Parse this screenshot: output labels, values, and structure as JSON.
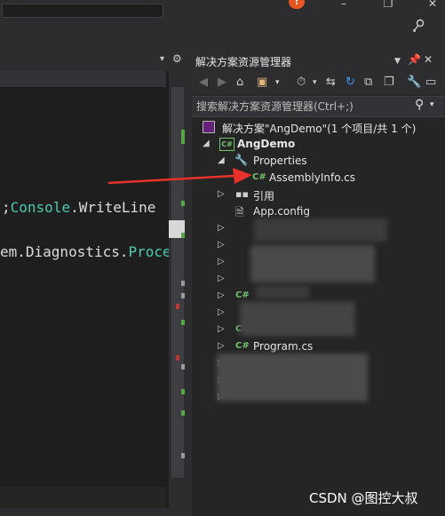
{
  "window": {
    "notification_badge": "!",
    "buttons": [
      "–",
      "❐",
      "✕"
    ]
  },
  "editor": {
    "code_lines": [
      {
        "parts": [
          {
            "t": ";",
            "k": "plain"
          },
          {
            "t": "Console",
            "k": "type"
          },
          {
            "t": ".WriteLine",
            "k": "member"
          }
        ]
      },
      {
        "parts": [
          {
            "t": "em.Diagnostics.",
            "k": "plain"
          },
          {
            "t": "Proce",
            "k": "type"
          }
        ]
      }
    ]
  },
  "solution_explorer": {
    "title": "解决方案资源管理器",
    "search_placeholder": "搜索解决方案资源管理器(Ctrl+;)",
    "solution_label": "解决方案\"AngDemo\"(1 个项目/共 1 个)",
    "project_label": "AngDemo",
    "properties_label": "Properties",
    "assemblyinfo_label": "AssemblyInfo.cs",
    "references_label": "引用",
    "appconfig_label": "App.config",
    "program_label": "Program.cs",
    "csharp_glyph": "C#",
    "project_glyph": "C#"
  },
  "watermark": "CSDN @图控大叔",
  "colors": {
    "accent_red": "#e8312a",
    "csharp_green": "#71c36b"
  }
}
